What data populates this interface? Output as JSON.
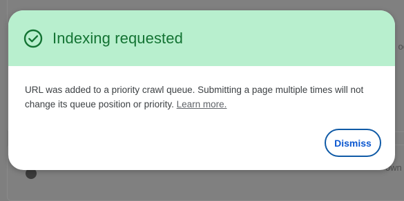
{
  "background": {
    "right_fragment": "oo",
    "bottom_right_fragment": "own f"
  },
  "dialog": {
    "icon": "check-circle-icon",
    "title": "Indexing requested",
    "title_color": "#137333",
    "header_bg": "#b8efce",
    "body_text": "URL was added to a priority crawl queue. Submitting a page multiple times will not change its queue position or priority.",
    "learn_more_label": "Learn more.",
    "dismiss_label": "Dismiss",
    "accent": "#0b57d0"
  }
}
